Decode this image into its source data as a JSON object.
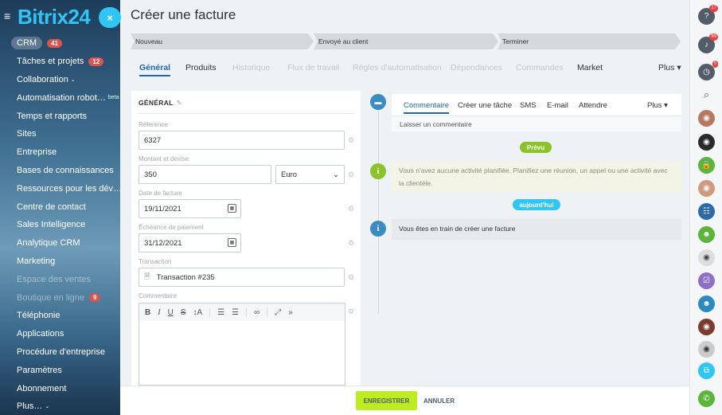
{
  "app": {
    "logo": "Bitrix24",
    "close_label": "×"
  },
  "sidebar": {
    "items": [
      {
        "label": "CRM",
        "count": "41",
        "active": true
      },
      {
        "label": "Tâches et projets",
        "count": "12"
      },
      {
        "label": "Collaboration",
        "chevron": "⌄"
      },
      {
        "label": "Automatisation robot…",
        "sup": "beta"
      },
      {
        "label": "Temps et rapports"
      },
      {
        "label": "Sites"
      },
      {
        "label": "Entreprise"
      },
      {
        "label": "Bases de connaissances"
      },
      {
        "label": "Ressources pour les dév…"
      },
      {
        "label": "Centre de contact"
      },
      {
        "label": "Sales Intelligence"
      },
      {
        "label": "Analytique CRM"
      },
      {
        "label": "Marketing"
      },
      {
        "label": "Espace des ventes",
        "dim": true
      },
      {
        "label": "Boutique en ligne",
        "count": "9",
        "dim": true
      },
      {
        "label": "Téléphonie"
      },
      {
        "label": "Applications"
      },
      {
        "label": "Procédure d'entreprise"
      },
      {
        "label": "Paramètres"
      },
      {
        "label": "Abonnement"
      },
      {
        "label": "Plus…",
        "chevron": "⌄"
      }
    ]
  },
  "page": {
    "title": "Créer une facture"
  },
  "stages": [
    "Nouveau",
    "Envoyé au client",
    "Terminer"
  ],
  "tabs": [
    "Général",
    "Produits",
    "Historique",
    "Flux de travail",
    "Règles d'automatisation",
    "Dépendances",
    "Commandes",
    "Market",
    "Plus ▾"
  ],
  "form": {
    "header": "GÉNÉRAL",
    "reference_label": "Référence",
    "reference_value": "6327",
    "amount_label": "Montant et devise",
    "amount_value": "350",
    "currency_value": "Euro",
    "invoice_date_label": "Date de facture",
    "invoice_date_value": "19/11/2021",
    "due_date_label": "Échéance de paiement",
    "due_date_value": "31/12/2021",
    "transaction_label": "Transaction",
    "transaction_value": "Transaction #235",
    "comment_label": "Commentaire"
  },
  "timeline": {
    "composer_tabs": [
      "Commentaire",
      "Créer une tâche",
      "SMS",
      "E-mail",
      "Attendre",
      "Plus ▾"
    ],
    "composer_placeholder": "Laisser un commentaire",
    "planned_pill": "Prévu",
    "planned_text": "Vous n'avez aucune activité planifiée. Planifiez une réunion, un appel ou une activité avec la clientèle.",
    "today_pill": "aujourd'hui",
    "today_text": "Vous êtes en train de créer une facture"
  },
  "footer": {
    "save": "ENREGISTRER",
    "cancel": "ANNULER"
  },
  "rightbar": {
    "badges": [
      "17",
      "99",
      "5"
    ]
  },
  "colors": {
    "accent": "#2fc6f6",
    "save": "#bbed21",
    "link": "#2067b0",
    "planned_pill": "#8ac32a",
    "today_pill": "#2fc6f6",
    "info_green": "#8ac32a",
    "info_blue": "#3a8ac4"
  }
}
